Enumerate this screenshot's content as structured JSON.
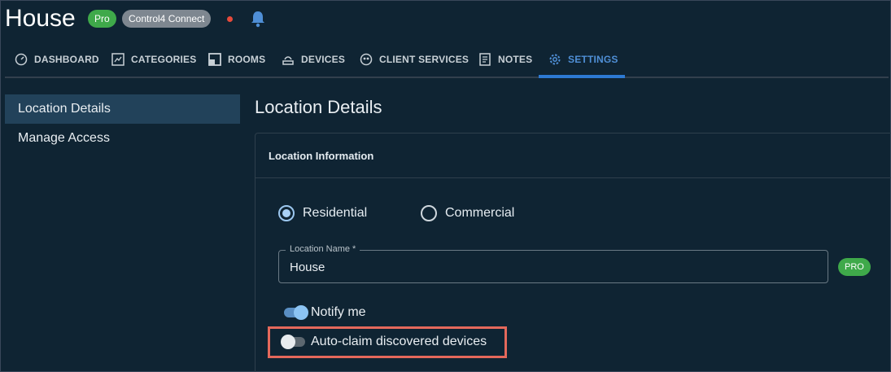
{
  "header": {
    "title": "House",
    "pro_badge": "Pro",
    "connect_badge": "Control4 Connect",
    "status_color": "#e74a3b"
  },
  "tabs": [
    {
      "label": "DASHBOARD",
      "icon": "gauge-icon"
    },
    {
      "label": "CATEGORIES",
      "icon": "chart-icon"
    },
    {
      "label": "ROOMS",
      "icon": "room-icon"
    },
    {
      "label": "DEVICES",
      "icon": "device-icon"
    },
    {
      "label": "CLIENT SERVICES",
      "icon": "support-icon"
    },
    {
      "label": "NOTES",
      "icon": "notes-icon"
    },
    {
      "label": "SETTINGS",
      "icon": "gear-icon",
      "active": true
    }
  ],
  "sidebar": {
    "items": [
      {
        "label": "Location Details",
        "active": true
      },
      {
        "label": "Manage Access"
      }
    ]
  },
  "main": {
    "title": "Location Details",
    "card_title": "Location Information",
    "location_type": {
      "options": [
        "Residential",
        "Commercial"
      ],
      "selected": "Residential"
    },
    "location_name": {
      "label": "Location Name *",
      "value": "House"
    },
    "pro_chip": "PRO",
    "notify_toggle": {
      "label": "Notify me",
      "on": true
    },
    "auto_claim_toggle": {
      "label": "Auto-claim discovered devices",
      "on": false
    }
  },
  "colors": {
    "background": "#0f2433",
    "accent": "#2d7ad3",
    "highlight": "#e4685b",
    "pro_green": "#3fa94a"
  }
}
